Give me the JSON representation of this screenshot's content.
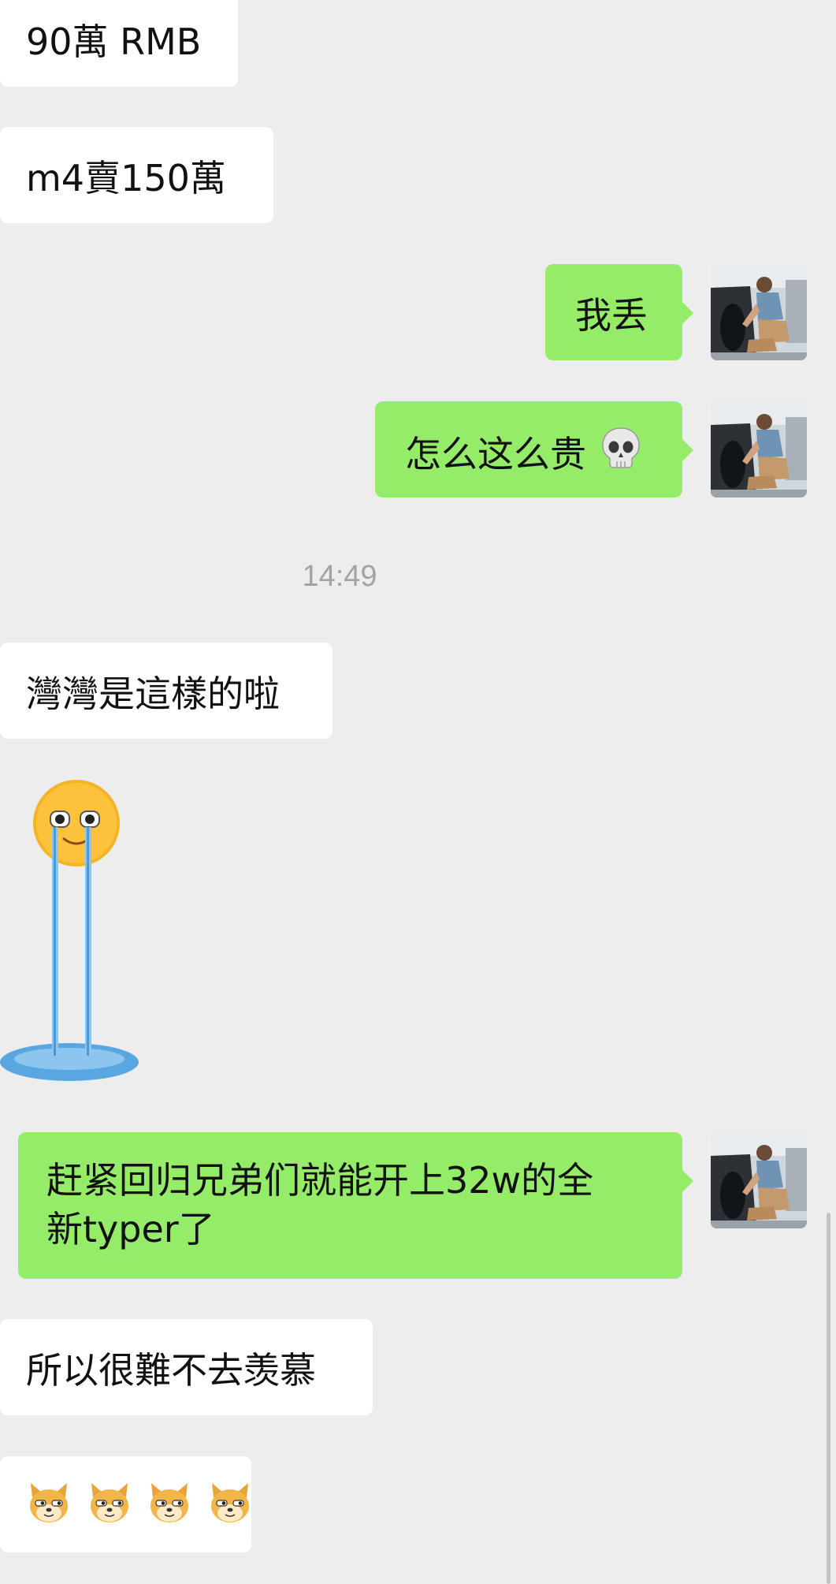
{
  "messages": [
    {
      "side": "in",
      "text": "90萬 RMB"
    },
    {
      "side": "in",
      "text": "m4賣150萬"
    },
    {
      "side": "out",
      "text": "我丢"
    },
    {
      "side": "out",
      "text": "怎么这么贵",
      "emoji": "skull-emoji"
    },
    {
      "side": "in",
      "text": "灣灣是這樣的啦"
    },
    {
      "side": "in",
      "sticker": "crying-waterfall-face-sticker"
    },
    {
      "side": "out",
      "line1": "赶紧回归兄弟们就能开上32w的全",
      "line2": "新typer了"
    },
    {
      "side": "in",
      "text": "所以很難不去羡慕"
    },
    {
      "side": "in",
      "emojis": [
        "doge-emoji",
        "doge-emoji",
        "doge-emoji",
        "doge-emoji"
      ]
    }
  ],
  "timestamp": "14:49",
  "colors": {
    "background": "#ededed",
    "incoming_bubble": "#ffffff",
    "outgoing_bubble": "#95ec69",
    "timestamp_text": "#a3a3a3"
  }
}
